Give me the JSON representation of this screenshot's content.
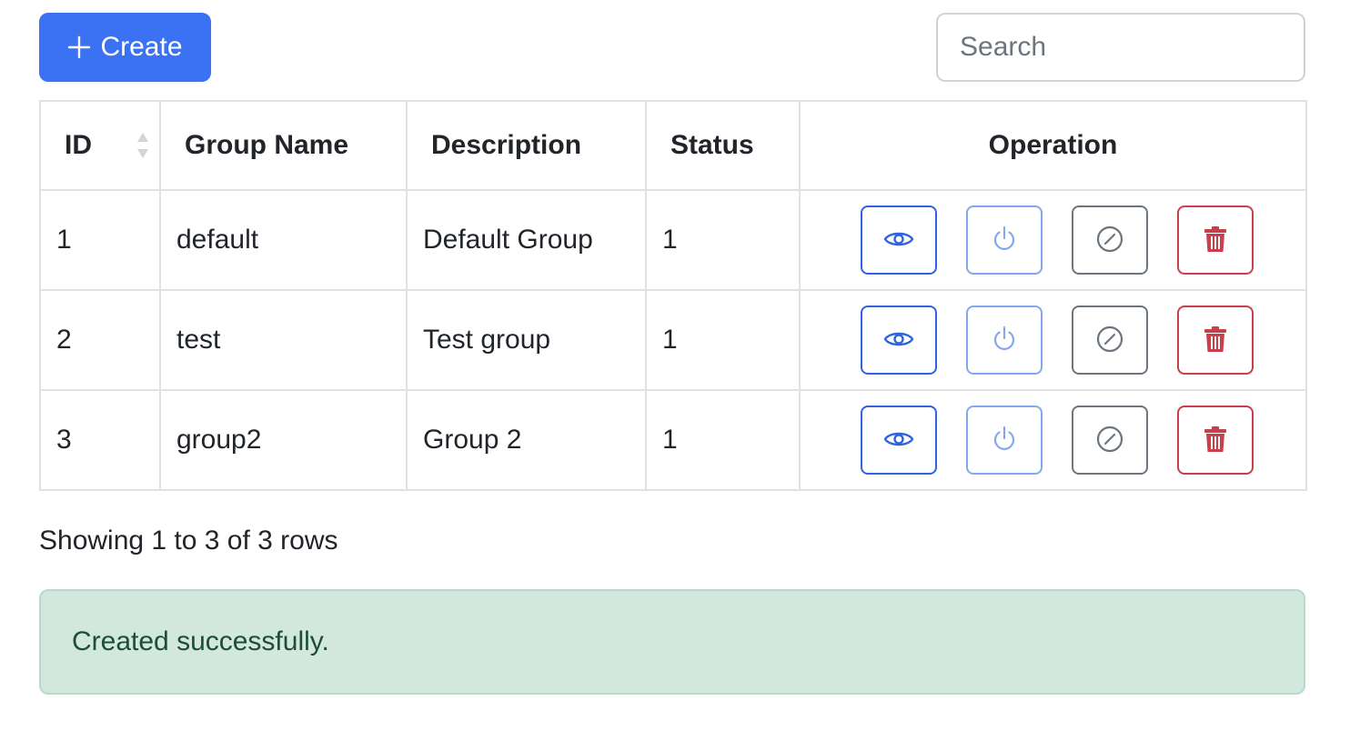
{
  "toolbar": {
    "create_label": "Create",
    "search_placeholder": "Search"
  },
  "table": {
    "headers": {
      "id": "ID",
      "group_name": "Group Name",
      "description": "Description",
      "status": "Status",
      "operation": "Operation"
    },
    "rows": [
      {
        "id": "1",
        "group_name": "default",
        "description": "Default Group",
        "status": "1"
      },
      {
        "id": "2",
        "group_name": "test",
        "description": "Test group",
        "status": "1"
      },
      {
        "id": "3",
        "group_name": "group2",
        "description": "Group 2",
        "status": "1"
      }
    ],
    "operations": [
      "eye-icon",
      "power-icon",
      "disable-icon",
      "trash-icon"
    ]
  },
  "summary": "Showing 1 to 3 of 3 rows",
  "alert": {
    "message": "Created successfully.",
    "type": "success"
  },
  "colors": {
    "primary": "#3b71f3",
    "view": "#2f63e0",
    "power": "#86a7ef",
    "disable": "#6c757d",
    "delete": "#c9404c",
    "success_bg": "#d2e7dd",
    "success_text": "#1d4d35"
  }
}
